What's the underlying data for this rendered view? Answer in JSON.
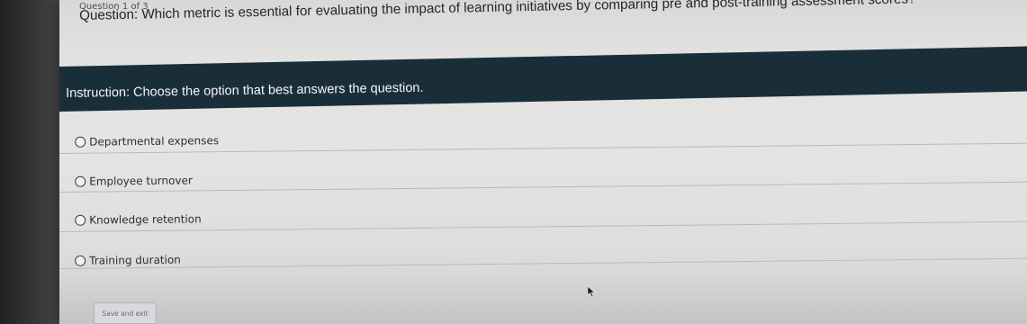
{
  "quiz": {
    "counter": "Question 1 of 3",
    "question": "Question: Which metric is essential for evaluating the impact of learning initiatives by comparing pre and post-training assessment scores?",
    "instruction": "Instruction: Choose the option that best answers the question.",
    "options": [
      {
        "label": "Departmental expenses"
      },
      {
        "label": "Employee turnover"
      },
      {
        "label": "Knowledge retention"
      },
      {
        "label": "Training duration"
      }
    ],
    "save_label": "Save and exit",
    "submit_label": "Submit answer"
  },
  "colors": {
    "instruction_band": "#1a2e3a",
    "page_background": "#e4e4e3",
    "text": "#23262a"
  }
}
